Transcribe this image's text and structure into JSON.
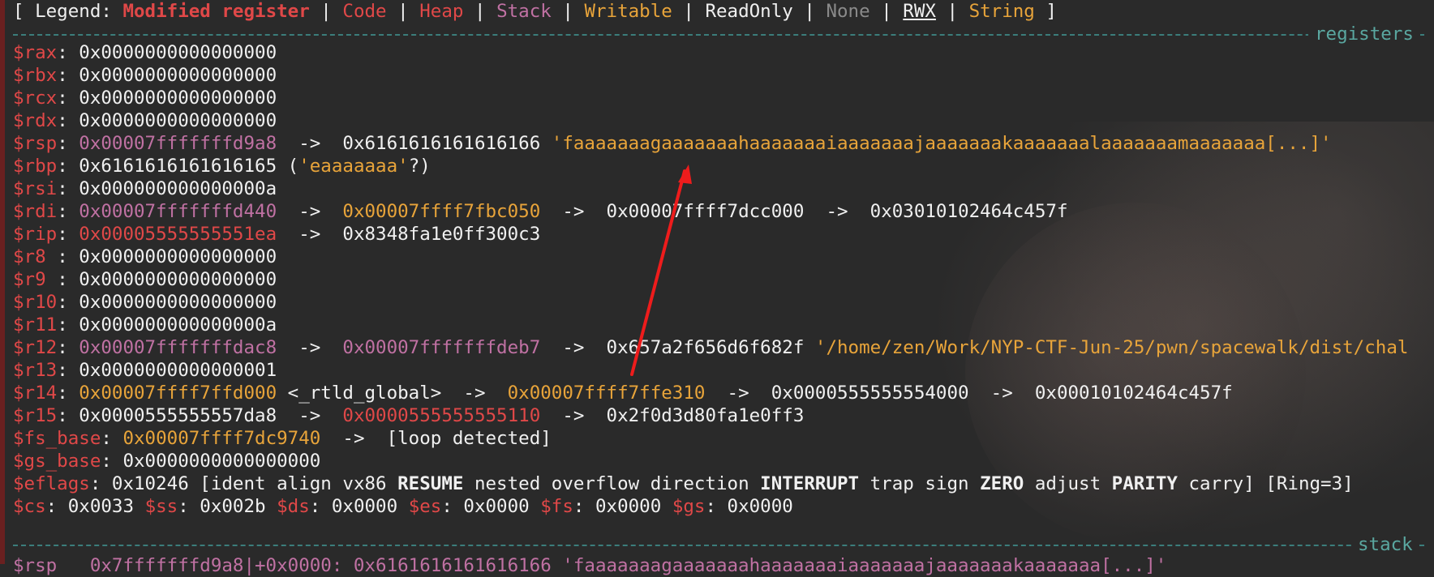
{
  "legend": {
    "open": "[ Legend: ",
    "modified": "Modified register",
    "code": "Code",
    "heap": "Heap",
    "stack": "Stack",
    "writable": "Writable",
    "readonly": "ReadOnly",
    "none": "None",
    "rwx": "RWX",
    "string": "String",
    "close": " ]",
    "bar": " | "
  },
  "sections": {
    "registers": "registers",
    "stack": "stack"
  },
  "regs": {
    "rax": {
      "name": "$rax",
      "sep": ": ",
      "val": "0x0000000000000000"
    },
    "rbx": {
      "name": "$rbx",
      "sep": ": ",
      "val": "0x0000000000000000"
    },
    "rcx": {
      "name": "$rcx",
      "sep": ": ",
      "val": "0x0000000000000000"
    },
    "rdx": {
      "name": "$rdx",
      "sep": ": ",
      "val": "0x0000000000000000"
    },
    "rsp": {
      "name": "$rsp",
      "sep": ": ",
      "val": "0x00007fffffffd9a8",
      "a1": "  ->  ",
      "t1": "0x6161616161616166",
      "str": " 'faaaaaaagaaaaaaahaaaaaaaiaaaaaaajaaaaaaakaaaaaaalaaaaaaamaaaaaaa[...]'"
    },
    "rbp": {
      "name": "$rbp",
      "sep": ": ",
      "val": "0x6161616161616165",
      "p1": " (",
      "str": "'eaaaaaaa'",
      "p2": "?)"
    },
    "rsi": {
      "name": "$rsi",
      "sep": ": ",
      "val": "0x000000000000000a"
    },
    "rdi": {
      "name": "$rdi",
      "sep": ": ",
      "val": "0x00007fffffffd440",
      "a1": "  ->  ",
      "t1": "0x00007ffff7fbc050",
      "a2": "  ->  ",
      "t2": "0x00007ffff7dcc000",
      "a3": "  ->  ",
      "t3": "0x03010102464c457f"
    },
    "rip": {
      "name": "$rip",
      "sep": ": ",
      "val": "0x00005555555551ea",
      "a1": "  ->  ",
      "t1": "0x8348fa1e0ff300c3"
    },
    "r8": {
      "name": "$r8 ",
      "sep": ": ",
      "val": "0x0000000000000000"
    },
    "r9": {
      "name": "$r9 ",
      "sep": ": ",
      "val": "0x0000000000000000"
    },
    "r10": {
      "name": "$r10",
      "sep": ": ",
      "val": "0x0000000000000000"
    },
    "r11": {
      "name": "$r11",
      "sep": ": ",
      "val": "0x000000000000000a"
    },
    "r12": {
      "name": "$r12",
      "sep": ": ",
      "val": "0x00007fffffffdac8",
      "a1": "  ->  ",
      "t1": "0x00007fffffffdeb7",
      "a2": "  ->  ",
      "t2": "0x657a2f656d6f682f",
      "str": " '/home/zen/Work/NYP-CTF-Jun-25/pwn/spacewalk/dist/chal"
    },
    "r13": {
      "name": "$r13",
      "sep": ": ",
      "val": "0x0000000000000001"
    },
    "r14": {
      "name": "$r14",
      "sep": ": ",
      "val": "0x00007ffff7ffd000",
      "sym": " <_rtld_global>",
      "a1": "  ->  ",
      "t1": "0x00007ffff7ffe310",
      "a2": "  ->  ",
      "t2": "0x0000555555554000",
      "a3": "  ->  ",
      "t3": "0x00010102464c457f"
    },
    "r15": {
      "name": "$r15",
      "sep": ": ",
      "val": "0x0000555555557da8",
      "a1": "  ->  ",
      "t1": "0x0000555555555110",
      "a2": "  ->  ",
      "t2": "0x2f0d3d80fa1e0ff3"
    },
    "fs_base": {
      "name": "$fs_base",
      "sep": ": ",
      "val": "0x00007ffff7dc9740",
      "a1": "  ->  ",
      "t1": "[loop detected]"
    },
    "gs_base": {
      "name": "$gs_base",
      "sep": ": ",
      "val": "0x0000000000000000"
    },
    "eflags": {
      "name": "$eflags",
      "sep": ": ",
      "val": "0x10246",
      "open": " [",
      "f1": "ident align vx86 ",
      "f2": "RESUME",
      "f3": " nested overflow direction ",
      "f4": "INTERRUPT",
      "f5": " trap sign ",
      "f6": "ZERO",
      "f7": " adjust ",
      "f8": "PARITY",
      "f9": " carry",
      "close": "] [Ring=3]"
    }
  },
  "segs": {
    "cs": {
      "name": "$cs",
      "val": ": 0x0033 "
    },
    "ss": {
      "name": "$ss",
      "val": ": 0x002b "
    },
    "ds": {
      "name": "$ds",
      "val": ": 0x0000 "
    },
    "es": {
      "name": "$es",
      "val": ": 0x0000 "
    },
    "fs": {
      "name": "$fs",
      "val": ": 0x0000 "
    },
    "gs": {
      "name": "$gs",
      "val": ": 0x0000"
    }
  },
  "stack_row_partial": "$rsp   0x7fffffffd9a8|+0x0000: 0x6161616161616166 'faaaaaaagaaaaaaahaaaaaaaiaaaaaaajaaaaaaakaaaaaaa[...]'",
  "colors": {
    "register": "#e04848",
    "heap": "#e04848",
    "stack": "#c071a3",
    "writable": "#e8a43a",
    "readonly": "#f0f0f0",
    "none": "#8a8a8a",
    "separator": "#3b7d7b",
    "annotation_arrow": "#ee1c1c"
  }
}
